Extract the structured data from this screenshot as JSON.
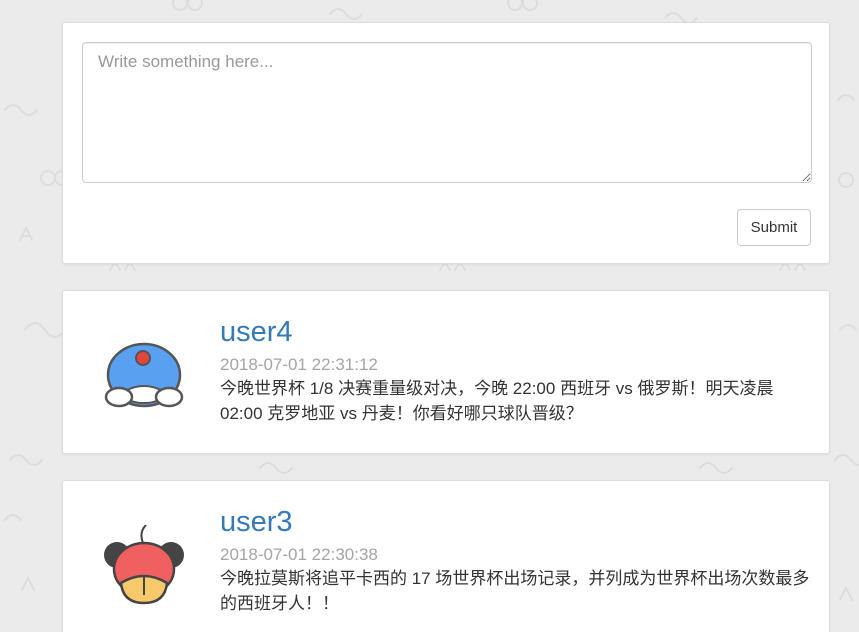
{
  "compose": {
    "placeholder": "Write something here...",
    "value": "",
    "submit_label": "Submit"
  },
  "posts": [
    {
      "username": "user4",
      "timestamp": "2018-07-01 22:31:12",
      "content": "今晚世界杯 1/8 决赛重量级对决，今晚 22:00 西班牙 vs 俄罗斯！明天凌晨 02:00 克罗地亚 vs 丹麦！你看好哪只球队晋级？",
      "avatar_icon": "doraemon-avatar-icon"
    },
    {
      "username": "user3",
      "timestamp": "2018-07-01 22:30:38",
      "content": "今晚拉莫斯将追平卡西的 17 场世界杯出场记录，并列成为世界杯出场次数最多的西班牙人！！",
      "avatar_icon": "mickey-avatar-icon"
    }
  ],
  "colors": {
    "background": "#ebebeb",
    "link": "#337ab7",
    "muted": "#a5a5a5",
    "text": "#333333"
  }
}
